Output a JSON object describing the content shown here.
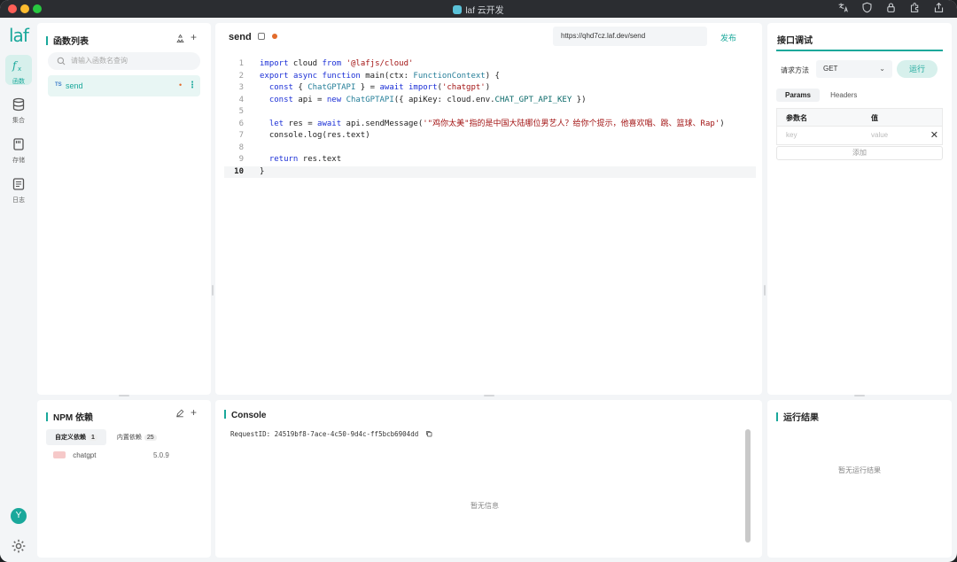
{
  "window": {
    "title": "laf 云开发"
  },
  "rail": {
    "logo": "laf",
    "items": [
      {
        "label": "函数",
        "icon": "function-icon"
      },
      {
        "label": "集合",
        "icon": "database-icon"
      },
      {
        "label": "存储",
        "icon": "storage-icon"
      },
      {
        "label": "日志",
        "icon": "log-icon"
      }
    ],
    "avatar": "Y"
  },
  "function_list": {
    "title": "函数列表",
    "search_placeholder": "请输入函数名查询",
    "items": [
      {
        "lang": "TS",
        "name": "send"
      }
    ]
  },
  "editor": {
    "function_name": "send",
    "url": "https://qhd7cz.laf.dev/send",
    "publish_label": "发布",
    "line_numbers": [
      "1",
      "2",
      "3",
      "4",
      "5",
      "6",
      "7",
      "8",
      "9",
      "10"
    ],
    "code_lines": [
      "import cloud from '@lafjs/cloud'",
      "export async function main(ctx: FunctionContext) {",
      "  const { ChatGPTAPI } = await import('chatgpt')",
      "  const api = new ChatGPTAPI({ apiKey: cloud.env.CHAT_GPT_API_KEY })",
      "",
      "  let res = await api.sendMessage('\"鸡你太美\"指的是中国大陆哪位男艺人？给你个提示，他喜欢唱、跳、篮球、Rap')",
      "  console.log(res.text)",
      "",
      "  return res.text",
      "}"
    ]
  },
  "api_debug": {
    "title": "接口调试",
    "method_label": "请求方法",
    "method": "GET",
    "run_label": "运行",
    "tabs": [
      "Params",
      "Headers"
    ],
    "table_headers": [
      "参数名",
      "值"
    ],
    "key_placeholder": "key",
    "value_placeholder": "value",
    "add_label": "添加"
  },
  "npm": {
    "title": "NPM 依赖",
    "tabs": [
      {
        "label": "自定义依赖",
        "count": "1"
      },
      {
        "label": "内置依赖",
        "count": "25"
      }
    ],
    "packages": [
      {
        "name": "chatgpt",
        "version": "5.0.9"
      }
    ]
  },
  "console": {
    "title": "Console",
    "request_id": "RequestID: 24519bf8-7ace-4c50-9d4c-ff5bcb6904dd",
    "empty_text": "暂无信息"
  },
  "result": {
    "title": "运行结果",
    "empty_text": "暂无运行结果"
  }
}
